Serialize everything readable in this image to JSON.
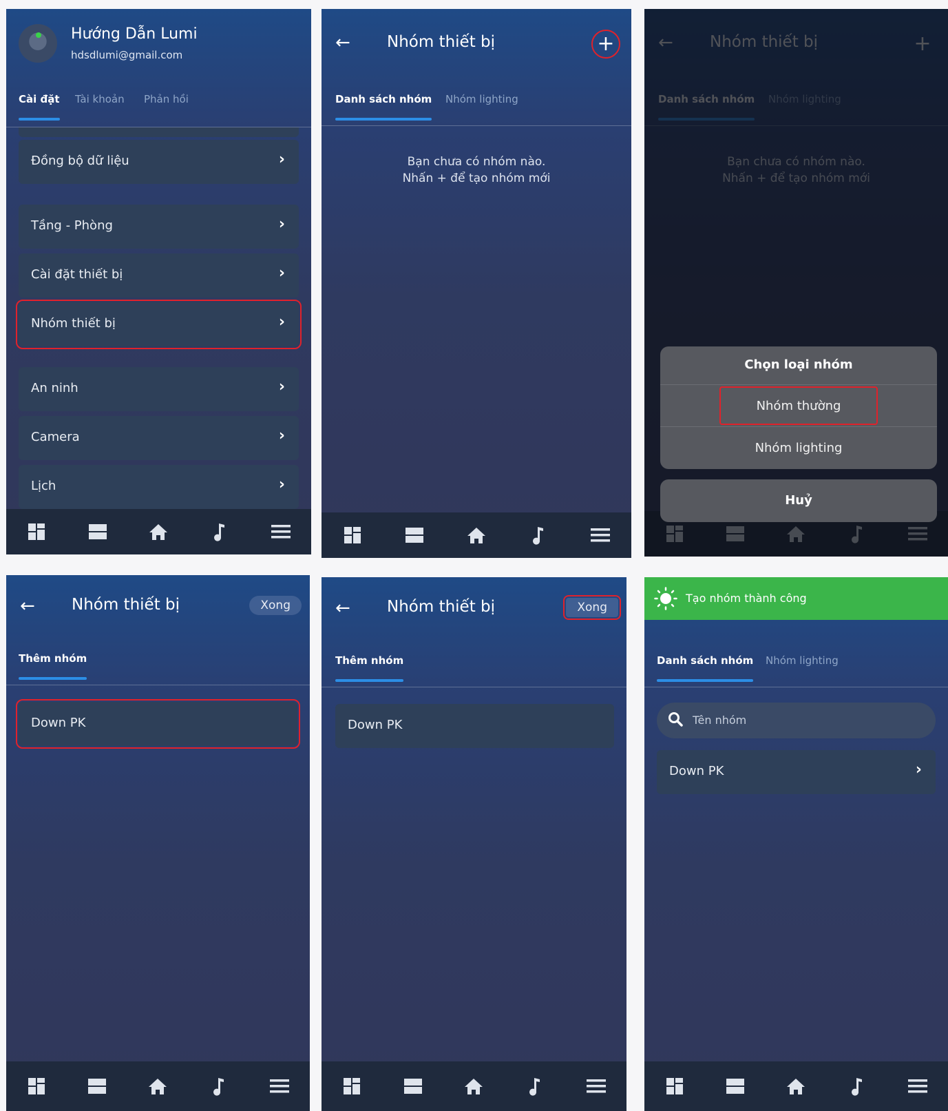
{
  "colors": {
    "accent": "#2c8ee6",
    "highlight": "#e0222b",
    "success": "#3bb54a"
  },
  "settings": {
    "profile_name": "Hướng Dẫn Lumi",
    "profile_email": "hdsdlumi@gmail.com",
    "tabs": [
      "Cài đặt",
      "Tài khoản",
      "Phản hồi"
    ],
    "items": [
      "Đồng bộ dữ liệu",
      "Tầng - Phòng",
      "Cài đặt thiết bị",
      "Nhóm thiết bị",
      "An ninh",
      "Camera",
      "Lịch"
    ]
  },
  "groups": {
    "title": "Nhóm thiết bị",
    "tab_list": "Danh sách nhóm",
    "tab_lighting": "Nhóm lighting",
    "empty_line1": "Bạn chưa có nhóm nào.",
    "empty_line2": "Nhấn + để tạo nhóm mới",
    "plus": "+"
  },
  "picker": {
    "title": "Chọn loại nhóm",
    "option_normal": "Nhóm thường",
    "option_lighting": "Nhóm lighting",
    "cancel": "Huỷ"
  },
  "add_group": {
    "tab": "Thêm nhóm",
    "done": "Xong",
    "group_name": "Down PK"
  },
  "result": {
    "toast": "Tạo nhóm thành công",
    "search_placeholder": "Tên nhóm",
    "group_name": "Down PK"
  },
  "nav_icons": [
    "dashboard-icon",
    "rooms-icon",
    "home-icon",
    "music-icon",
    "menu-icon"
  ]
}
